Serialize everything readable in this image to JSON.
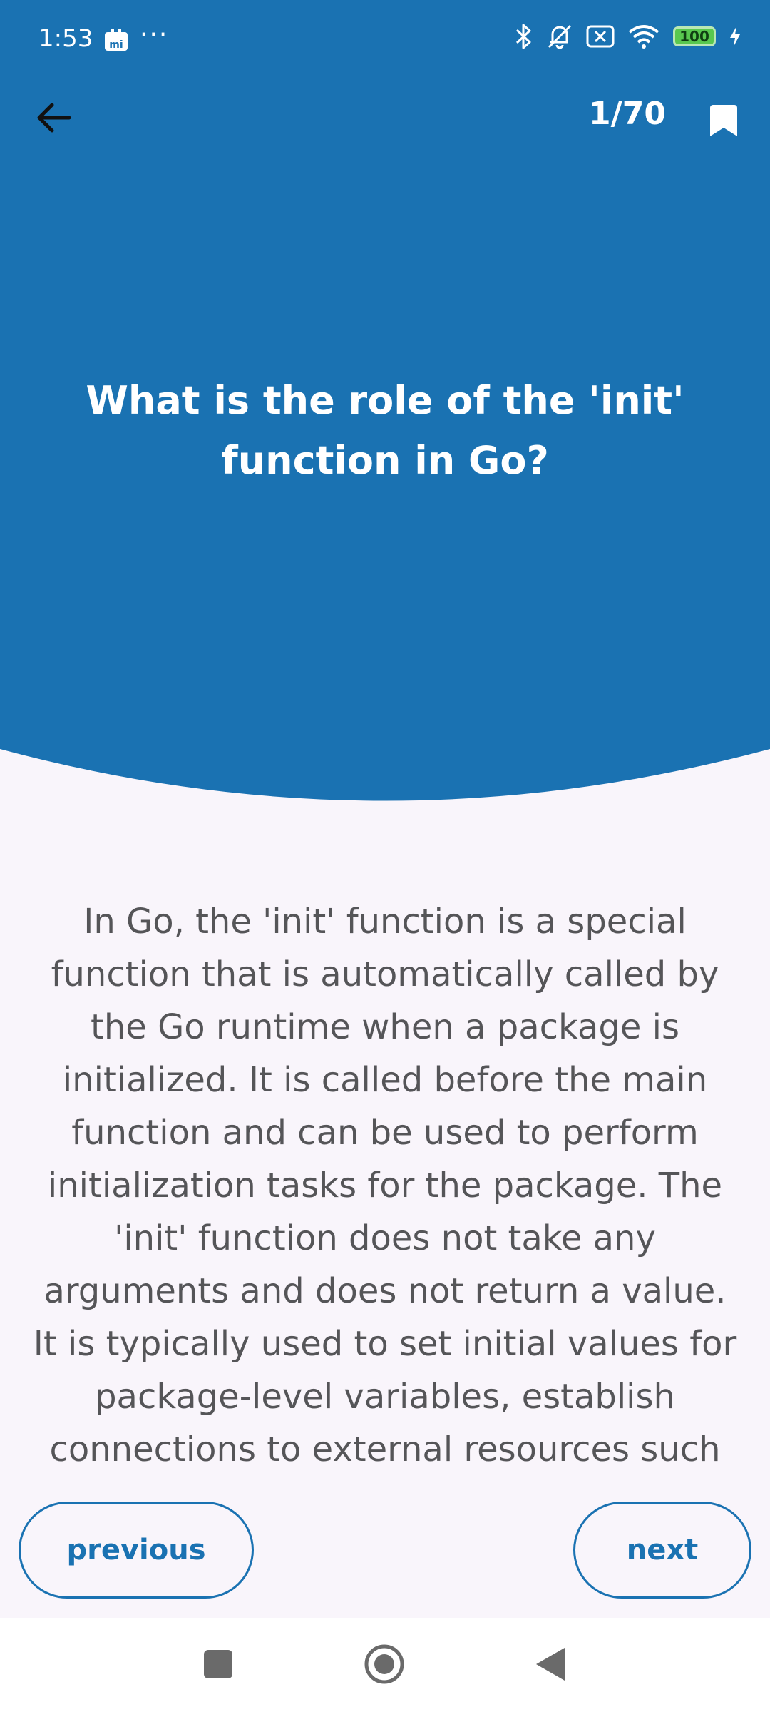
{
  "colors": {
    "brand": "#1a72b2",
    "background": "#f9f5fb",
    "answer_text": "#555558"
  },
  "status_bar": {
    "time": "1:53",
    "notification_icon": "mi-app-icon",
    "overflow": "···",
    "icons": [
      "bluetooth-icon",
      "bell-off-icon",
      "sim-x-icon",
      "wifi-icon",
      "battery-icon",
      "charging-icon"
    ],
    "battery_level": "100"
  },
  "toolbar": {
    "counter": "1/70",
    "back_icon": "arrow-left-icon",
    "bookmark_icon": "bookmark-icon"
  },
  "card": {
    "question": "What is the role of the 'init' function in Go?",
    "answer": "In Go, the 'init' function is a special function that is automatically called by the Go runtime when a package is initialized. It is called before the main function and can be used to perform initialization tasks for the package. The 'init' function does not take any arguments and does not return a value. It is typically used to set initial values for package-level variables, establish connections to external resources such"
  },
  "controls": {
    "previous_label": "previous",
    "next_label": "next"
  },
  "nav_bar": {
    "icons": [
      "recents-icon",
      "home-icon",
      "back-icon"
    ]
  }
}
